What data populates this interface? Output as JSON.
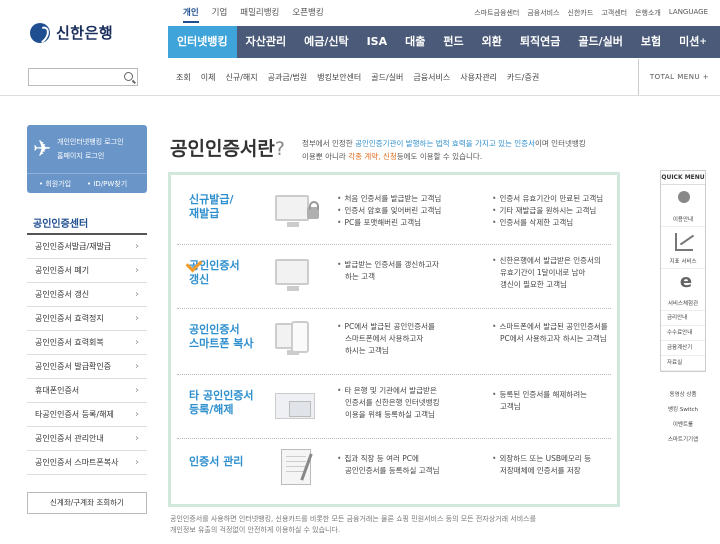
{
  "topnav": {
    "items": [
      "개인",
      "기업",
      "패밀리뱅킹",
      "오픈뱅킹"
    ],
    "links": [
      "스마트금융센터",
      "금융서비스",
      "신한카드",
      "고객센터",
      "은행소개",
      "LANGUAGE"
    ]
  },
  "logo": {
    "text": "신한은행"
  },
  "mainnav": {
    "items": [
      "인터넷뱅킹",
      "자산관리",
      "예금/신탁",
      "ISA",
      "대출",
      "펀드",
      "외환",
      "퇴직연금",
      "골드/실버",
      "보험",
      "미션"
    ]
  },
  "subnav": {
    "items": [
      "조회",
      "이체",
      "신규/해지",
      "공과금/법원",
      "뱅킹보안센터",
      "골드/실버",
      "금융서비스",
      "사용자관리",
      "카드/증권"
    ],
    "total_menu": "TOTAL MENU +"
  },
  "sidebar": {
    "login": {
      "internet_login": "개인인터넷뱅킹 로그인",
      "home_login": "홈페이지 로그인",
      "join": "• 회원가입",
      "id_pw": "• ID/PW찾기"
    },
    "title": "공인인증센터",
    "items": [
      "공인인증서발급/재발급",
      "공인인증서 폐기",
      "공인인증서 갱신",
      "공인인증서 효력정지",
      "공인인증서 효력회복",
      "공인인증서 발급확인증",
      "휴대폰인증서",
      "타공인인증서 등록/해제",
      "공인인증서 관리안내",
      "공인인증서 스마트폰복사"
    ],
    "lookup": "신계좌/구계좌 조회하기"
  },
  "content": {
    "title": "공인인증서란",
    "title_q": "?",
    "desc_a": "정부에서 인정한 ",
    "desc_hl": "공인인증기관이 발행하는 법적 효력을 가지고 있는 인증서",
    "desc_b": "이며 인터넷뱅킹 이용뿐 아니라 ",
    "desc_hl2": "각종 계약, 신청",
    "desc_c": "등에도 이용할 수 있습니다.",
    "rows": [
      {
        "title_1": "신규발급/",
        "title_2": "재발급",
        "col1": [
          "처음 인증서를 발급받는 고객님",
          "인증서 암호를 잊어버린 고객님",
          "PC를 포맷해버린 고객님"
        ],
        "col2": [
          "인증서 유효기간이 만료된 고객님",
          "기타 재발급을 원하시는 고객님",
          "인증서를 삭제한 고객님"
        ]
      },
      {
        "title_1": "공인인증서",
        "title_2": "갱신",
        "col1": [
          "발급받는 인증서를 갱신하고자",
          "하는 고객"
        ],
        "col2": [
          "신한은행에서 발급받은 인증서의",
          "유효기간이 1달이내로 남아",
          "갱신이 필요한 고객님"
        ]
      },
      {
        "title_1": "공인인증서",
        "title_2": "스마트폰 복사",
        "col1": [
          "PC에서 발급된 공인인증서를",
          "스마트폰에서 사용하고자",
          "하시는 고객님"
        ],
        "col2": [
          "스마트폰에서 발급된 공인인증서를",
          "PC에서 사용하고자 하시는 고객님"
        ]
      },
      {
        "title_1": "타 공인인증서",
        "title_2": "등록/해제",
        "col1": [
          "타 은행 및 기관에서 발급받은",
          "인증서를 신한은행 인터넷뱅킹",
          "이용을 위해 등록하실 고객님"
        ],
        "col2": [
          "등록된 인증서를 해제하려는",
          "고객님"
        ]
      },
      {
        "title_1": "인증서 관리",
        "title_2": "",
        "col1": [
          "집과 직장 등 여러 PC에",
          "공인인증서를 등록하실 고객님"
        ],
        "col2": [
          "외장하드 또는 USB메모리 등",
          "저장매체에 인증서를 저장"
        ]
      }
    ],
    "footnote_1": "공인인증서를 사용하면 인터넷뱅킹, 신용카드를 비롯한 모든 금융거래는 물론 쇼핑 민원서비스 등의 모든 전자상거래 서비스를",
    "footnote_2": "개인정보 유출의 걱정없이 안전하게 이용하실 수 있습니다."
  },
  "quick": {
    "title": "QUICK MENU",
    "icons": [
      {
        "label": "이용안내",
        "icon": "person-icon"
      },
      {
        "label": "지표 서비스",
        "icon": "chart-icon"
      },
      {
        "label": "서비스체험관",
        "icon": "e-icon"
      }
    ],
    "small": [
      "금리안내",
      "수수료안내",
      "금융계산기",
      "자료실"
    ],
    "bottom": [
      "동영상 상품",
      "뱅킹 Switch",
      "이벤트룰",
      "스마트기기앱"
    ]
  }
}
